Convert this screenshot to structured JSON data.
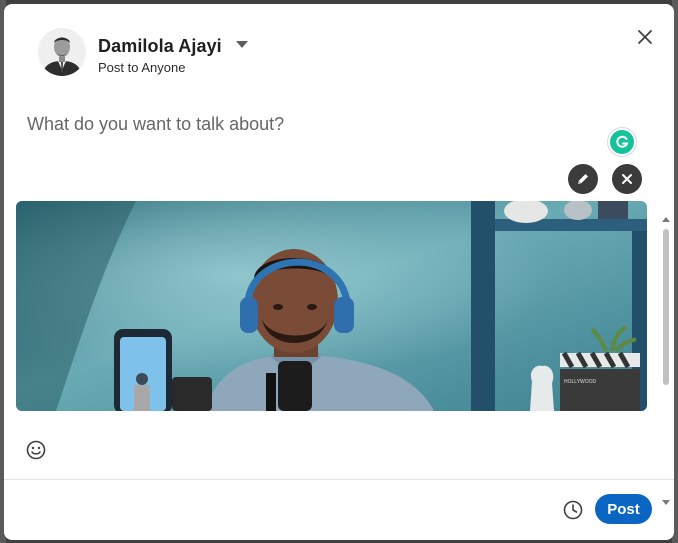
{
  "header": {
    "user_name": "Damilola Ajayi",
    "visibility": "Post to Anyone"
  },
  "editor": {
    "placeholder": "What do you want to talk about?"
  },
  "media": {
    "clapper_text": "HOLLYWOOD"
  },
  "footer": {
    "post_label": "Post"
  },
  "icons": {
    "close": "close-icon",
    "caret": "caret-down-icon",
    "grammarly": "grammarly-icon",
    "edit_image": "pencil-icon",
    "remove_image": "close-icon",
    "emoji": "smiley-icon",
    "schedule": "clock-icon"
  },
  "colors": {
    "post_button": "#0a66c2",
    "grammarly": "#15c39a",
    "image_action_bg": "#3b3b3b"
  }
}
